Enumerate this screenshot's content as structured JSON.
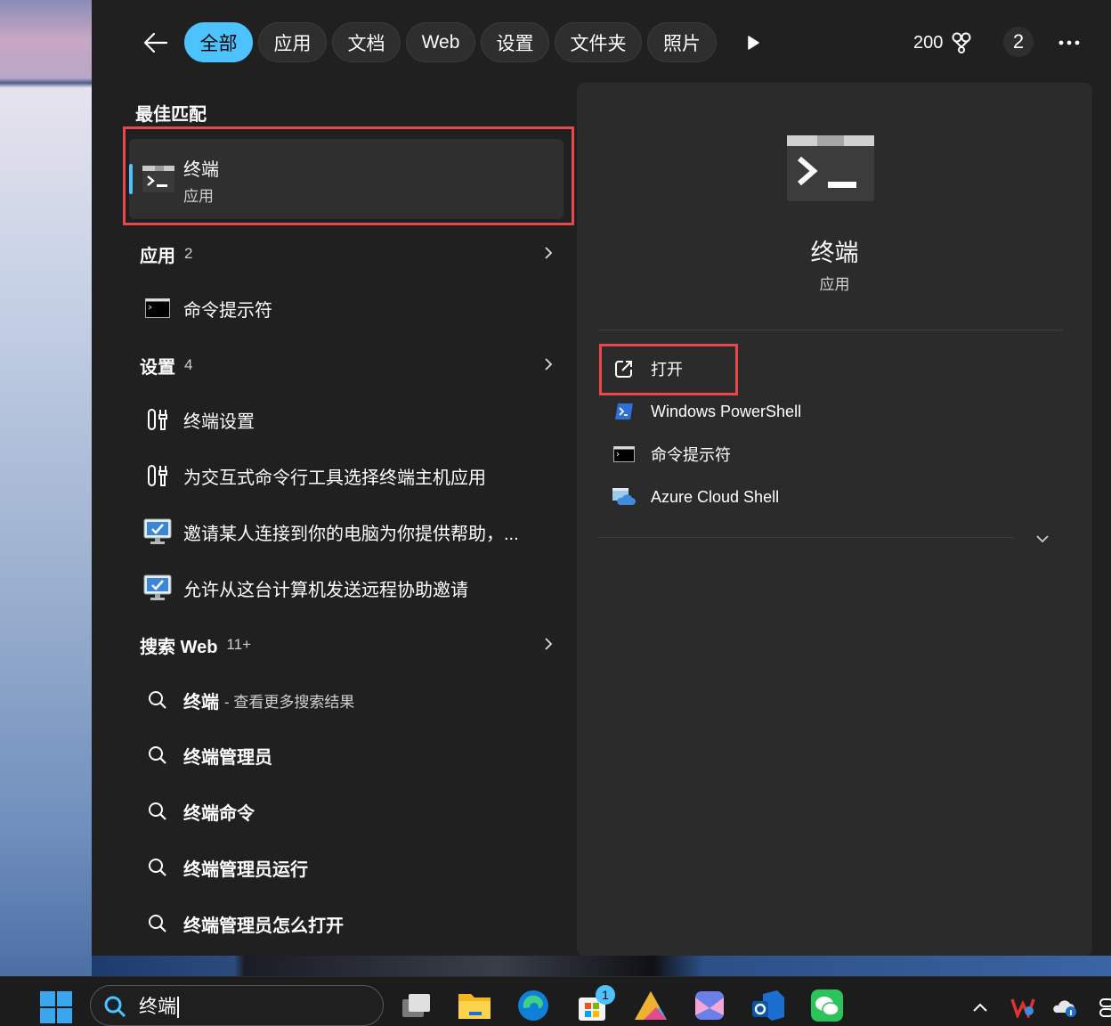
{
  "filter_bar": {
    "back_icon": "arrow-left-icon",
    "tabs": [
      {
        "label": "全部",
        "active": true
      },
      {
        "label": "应用",
        "active": false
      },
      {
        "label": "文档",
        "active": false
      },
      {
        "label": "Web",
        "active": false
      },
      {
        "label": "设置",
        "active": false
      },
      {
        "label": "文件夹",
        "active": false
      },
      {
        "label": "照片",
        "active": false
      }
    ],
    "play_icon": "play-icon",
    "points": "200",
    "points_icon": "rewards-trophy-icon",
    "notification_count": "2",
    "more_icon": "more-horizontal-icon"
  },
  "best_match": {
    "section_title": "最佳匹配",
    "title": "终端",
    "subtitle": "应用",
    "icon": "terminal-icon"
  },
  "groups": {
    "apps": {
      "title": "应用",
      "count": "2",
      "items": [
        {
          "label": "命令提示符",
          "icon": "command-prompt-icon"
        }
      ]
    },
    "settings": {
      "title": "设置",
      "count": "4",
      "items": [
        {
          "label": "终端设置",
          "icon": "settings-tool-icon"
        },
        {
          "label": "为交互式命令行工具选择终端主机应用",
          "icon": "settings-tool-icon"
        },
        {
          "label": "邀请某人连接到你的电脑为你提供帮助，...",
          "icon": "remote-assistance-icon"
        },
        {
          "label": "允许从这台计算机发送远程协助邀请",
          "icon": "remote-assistance-icon"
        }
      ]
    },
    "web": {
      "title": "搜索 Web",
      "count": "11+",
      "items": [
        {
          "label": "终端",
          "suffix": "- 查看更多搜索结果",
          "icon": "search-icon"
        },
        {
          "label": "终端管理员",
          "icon": "search-icon"
        },
        {
          "label": "终端命令",
          "icon": "search-icon"
        },
        {
          "label": "终端管理员运行",
          "icon": "search-icon"
        },
        {
          "label": "终端管理员怎么打开",
          "icon": "search-icon"
        }
      ]
    }
  },
  "preview": {
    "title": "终端",
    "subtitle": "应用",
    "actions": [
      {
        "label": "打开",
        "icon": "open-external-icon"
      },
      {
        "label": "Windows PowerShell",
        "icon": "powershell-icon"
      },
      {
        "label": "命令提示符",
        "icon": "command-prompt-icon"
      },
      {
        "label": "Azure Cloud Shell",
        "icon": "azure-cloud-shell-icon"
      }
    ],
    "expand_icon": "chevron-down-icon"
  },
  "taskbar": {
    "search_value": "终端",
    "store_badge": "1",
    "apps": [
      "task-view-icon",
      "file-explorer-icon",
      "edge-icon",
      "microsoft-store-icon",
      "copilot-icon",
      "photos-icon",
      "outlook-icon",
      "wechat-icon"
    ],
    "tray": [
      "chevron-up-icon",
      "wps-icon",
      "onedrive-icon",
      "system-tray-icon"
    ]
  },
  "colors": {
    "accent": "#4cc2ff",
    "highlight_box": "#e8484b",
    "panel_bg": "#202020",
    "preview_bg": "#2b2b2b"
  }
}
